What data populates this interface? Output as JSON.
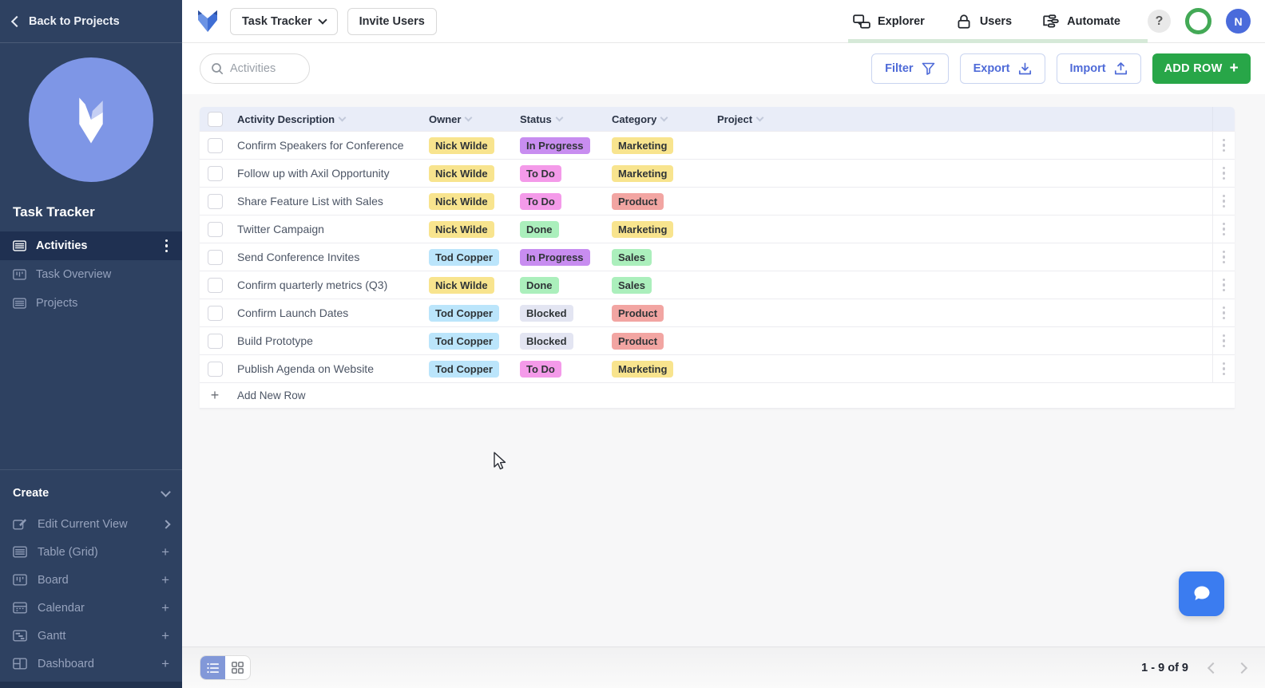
{
  "topbar": {
    "workspace_button": "Task Tracker",
    "invite_button": "Invite Users",
    "nav_items": [
      {
        "label": "Explorer",
        "icon": "explorer-icon"
      },
      {
        "label": "Users",
        "icon": "lock-icon"
      },
      {
        "label": "Automate",
        "icon": "automate-icon"
      }
    ],
    "help_label": "?",
    "avatar_initial": "N"
  },
  "sidebar": {
    "back_label": "Back to Projects",
    "workspace_title": "Task Tracker",
    "nav_items": [
      {
        "label": "Activities",
        "icon": "table-icon",
        "active": true
      },
      {
        "label": "Task Overview",
        "icon": "board-icon",
        "active": false
      },
      {
        "label": "Projects",
        "icon": "table-icon",
        "active": false
      }
    ],
    "create_section": {
      "title": "Create",
      "items": [
        {
          "label": "Edit Current View",
          "icon": "edit-icon",
          "action": "chevron"
        },
        {
          "label": "Table (Grid)",
          "icon": "table-icon",
          "action": "plus"
        },
        {
          "label": "Board",
          "icon": "board-icon",
          "action": "plus"
        },
        {
          "label": "Calendar",
          "icon": "calendar-icon",
          "action": "plus"
        },
        {
          "label": "Gantt",
          "icon": "gantt-icon",
          "action": "plus"
        },
        {
          "label": "Dashboard",
          "icon": "dashboard-icon",
          "action": "plus"
        }
      ]
    }
  },
  "toolbar": {
    "search_placeholder": "Activities",
    "filter_label": "Filter",
    "export_label": "Export",
    "import_label": "Import",
    "add_row_label": "ADD ROW",
    "add_row_plus": "+"
  },
  "table": {
    "columns": [
      "Activity Description",
      "Owner",
      "Status",
      "Category",
      "Project"
    ],
    "rows": [
      {
        "description": "Confirm Speakers for Conference",
        "owner": "Nick Wilde",
        "status": "In Progress",
        "category": "Marketing",
        "project": ""
      },
      {
        "description": "Follow up with Axil Opportunity",
        "owner": "Nick Wilde",
        "status": "To Do",
        "category": "Marketing",
        "project": ""
      },
      {
        "description": "Share Feature List with Sales",
        "owner": "Nick Wilde",
        "status": "To Do",
        "category": "Product",
        "project": ""
      },
      {
        "description": "Twitter Campaign",
        "owner": "Nick Wilde",
        "status": "Done",
        "category": "Marketing",
        "project": ""
      },
      {
        "description": "Send Conference Invites",
        "owner": "Tod Copper",
        "status": "In Progress",
        "category": "Sales",
        "project": ""
      },
      {
        "description": "Confirm quarterly metrics (Q3)",
        "owner": "Nick Wilde",
        "status": "Done",
        "category": "Sales",
        "project": ""
      },
      {
        "description": "Confirm Launch Dates",
        "owner": "Tod Copper",
        "status": "Blocked",
        "category": "Product",
        "project": ""
      },
      {
        "description": "Build Prototype",
        "owner": "Tod Copper",
        "status": "Blocked",
        "category": "Product",
        "project": ""
      },
      {
        "description": "Publish Agenda on Website",
        "owner": "Tod Copper",
        "status": "To Do",
        "category": "Marketing",
        "project": ""
      }
    ],
    "add_new_row_label": "Add New Row"
  },
  "footer": {
    "pagination": "1 - 9 of 9"
  },
  "colors": {
    "badge_owner": {
      "Nick Wilde": "#f8e48e",
      "Tod Copper": "#bbe5fb"
    },
    "badge_status": {
      "In Progress": "#c88df0",
      "To Do": "#f49ae9",
      "Done": "#abefbc",
      "Blocked": "#e3e5f2"
    },
    "badge_category": {
      "Marketing": "#f8e48e",
      "Sales": "#abefbc",
      "Product": "#f2a5a2"
    },
    "accent_green": "#28a648",
    "accent_blue": "#4f6bd8",
    "sidebar_bg": "#2e4161",
    "header_bg": "#e9edf8"
  }
}
